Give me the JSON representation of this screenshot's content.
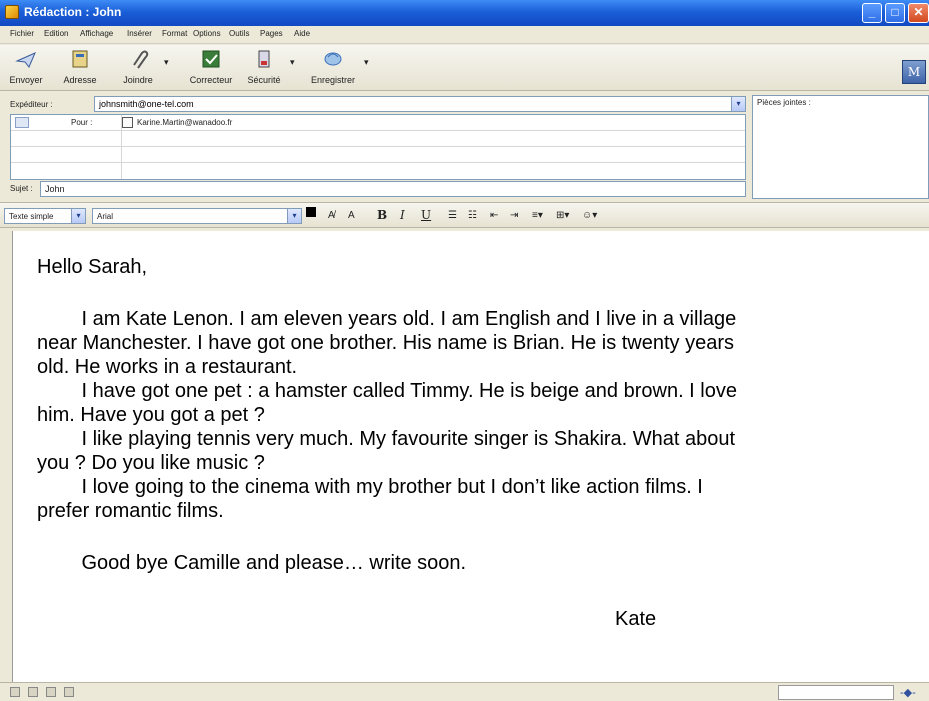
{
  "window": {
    "title": "Rédaction : John",
    "min_glyph": "_",
    "max_glyph": "□",
    "close_glyph": "✕"
  },
  "menu": [
    "Fichier",
    "Edition",
    "Affichage",
    "Insérer",
    "Format",
    "Options",
    "Outils",
    "Pages",
    "Aide"
  ],
  "toolbar": {
    "buttons": [
      {
        "label": "Envoyer",
        "icon": "send-icon"
      },
      {
        "label": "Adresse",
        "icon": "address-book-icon"
      },
      {
        "label": "Joindre",
        "icon": "attach-icon"
      },
      {
        "label": "Correcteur",
        "icon": "spellcheck-icon"
      },
      {
        "label": "Sécurité",
        "icon": "security-icon"
      },
      {
        "label": "Enregistrer",
        "icon": "save-icon"
      }
    ],
    "logo_glyph": "M"
  },
  "header": {
    "from_label": "Expéditeur :",
    "from_value": "johnsmith@one-tel.com",
    "to_label": "Pour :",
    "to_value": "Karine.Martin@wanadoo.fr",
    "subject_label": "Sujet :",
    "subject_value": "John",
    "attachments_label": "Pièces jointes :"
  },
  "format": {
    "text_mode": "Texte simple",
    "font": "Arial",
    "bold": "B",
    "italic": "I",
    "underline": "U"
  },
  "message": {
    "greeting": "Hello Sarah,",
    "lines": [
      "        I am Kate Lenon. I am eleven years old. I am English and I live in a village",
      "near Manchester. I have got one brother. His name is Brian. He is twenty years",
      "old. He works in a restaurant.",
      "        I have got one pet : a hamster called Timmy. He is beige and brown. I love",
      "him. Have you got a pet ?",
      "        I like playing tennis very much. My favourite singer is Shakira. What about",
      "you ? Do you like music ?",
      "        I love going to the cinema with my brother but I don’t like action films. I",
      "prefer romantic films."
    ],
    "closing": "        Good bye Camille and please… write soon.",
    "signature": "Kate"
  }
}
